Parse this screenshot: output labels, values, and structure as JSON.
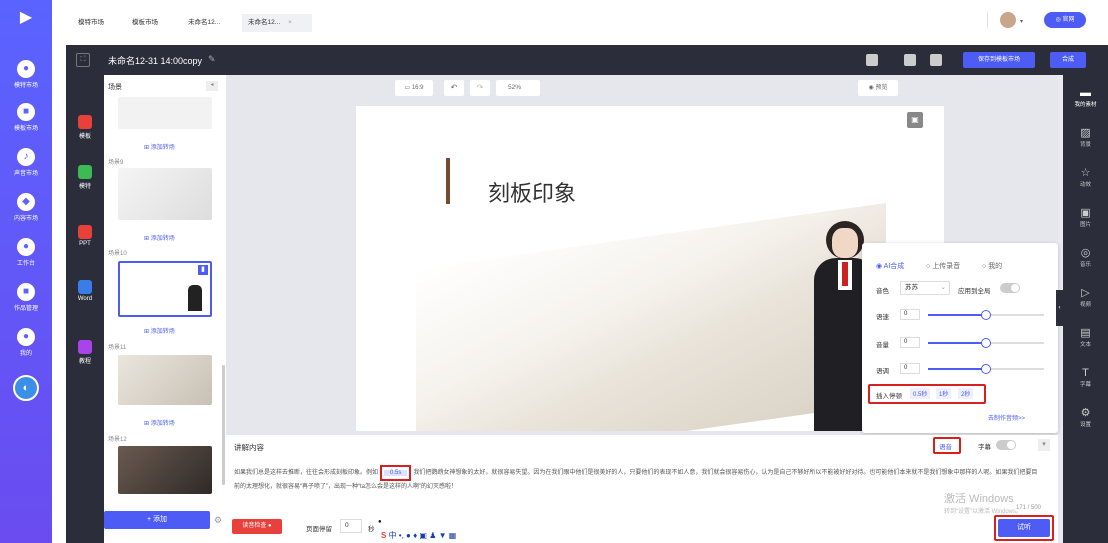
{
  "rail": {
    "items": [
      {
        "label": "模特市场",
        "icon": "person-icon"
      },
      {
        "label": "模板市场",
        "icon": "template-icon"
      },
      {
        "label": "声音市场",
        "icon": "voice-icon"
      },
      {
        "label": "内容市场",
        "icon": "content-icon"
      },
      {
        "label": "工作台",
        "icon": "workspace-icon"
      },
      {
        "label": "作品管理",
        "icon": "works-icon"
      },
      {
        "label": "我的",
        "icon": "user-icon"
      }
    ]
  },
  "topbar": {
    "tabs": [
      "模特市场",
      "模板市场",
      "未命名12...",
      "未命名12..."
    ],
    "official_label": "官网"
  },
  "editor": {
    "title": "未命名12-31 14:00copy",
    "save_template_label": "保存到模板市场",
    "compose_label": "合成"
  },
  "leftnav": {
    "items": [
      {
        "label": "模板",
        "color": "#e8413c"
      },
      {
        "label": "模特",
        "color": "#3cba54"
      },
      {
        "label": "PPT",
        "color": "#e8413c"
      },
      {
        "label": "Word",
        "color": "#3b7de8"
      },
      {
        "label": "教程",
        "color": "#a845e8"
      }
    ]
  },
  "scenes": {
    "header": "场景",
    "add_transition": "添加转场",
    "labels": [
      "场景9",
      "场景10",
      "场景11",
      "场景12"
    ],
    "add_button": "+ 添加"
  },
  "canvas": {
    "ratio": "16:9",
    "zoom": "52%",
    "preview": "预览",
    "slide_title": "刻板印象"
  },
  "voice_panel": {
    "modes": [
      "AI合成",
      "上传录音",
      "我的"
    ],
    "voice_label": "音色",
    "voice_value": "苏苏",
    "apply_all": "应用到全局",
    "speed_label": "语速",
    "speed_value": "0",
    "volume_label": "音量",
    "volume_value": "0",
    "pitch_label": "语调",
    "pitch_value": "0",
    "pause_label": "插入停顿",
    "pause_options": [
      "0.5秒",
      "1秒",
      "2秒"
    ],
    "link": "去制作音频>>"
  },
  "speech": {
    "header": "讲解内容",
    "voice_btn": "语音",
    "subtitle": "字幕",
    "text_before": "如果我们总是这样去推断，往往会形成刻板印象。例如",
    "pause_tag": "0.5s",
    "text_after": "我们把鹦鹉女神想象的太好，就很容易失望。因为在我们眼中他们是很美好的人，只要他们的表现不如人意，我们就会很容易伤心，认为是自己不够好所以不能被好好对待。也可能他们本来就不是我们想象中那样的人呢。如果我们把要目前的太理想化，就很容易“再子喷了”，出现一种“ta怎么会是这样的人啊”的幻灭感啦！",
    "counter": "171 / 500",
    "check_btn": "读音检查",
    "page_pause_label": "页面停留",
    "page_pause_value": "0",
    "seconds": "秒",
    "listen_btn": "试听",
    "ime_label": "中"
  },
  "rightbar": {
    "items": [
      {
        "label": "我的素材",
        "icon": "folder-icon"
      },
      {
        "label": "背景",
        "icon": "background-icon"
      },
      {
        "label": "动效",
        "icon": "motion-icon"
      },
      {
        "label": "图片",
        "icon": "image-icon"
      },
      {
        "label": "音乐",
        "icon": "music-icon"
      },
      {
        "label": "视频",
        "icon": "video-icon"
      },
      {
        "label": "文本",
        "icon": "text-icon"
      },
      {
        "label": "字幕",
        "icon": "subtitle-icon"
      },
      {
        "label": "设置",
        "icon": "settings-icon"
      }
    ]
  },
  "watermark": {
    "line1": "激活 Windows",
    "line2": "转到“设置”以激活 Windows。"
  },
  "colors": {
    "accent": "#4c5cf5",
    "dark": "#2b2d3a",
    "highlight": "#d82020"
  }
}
